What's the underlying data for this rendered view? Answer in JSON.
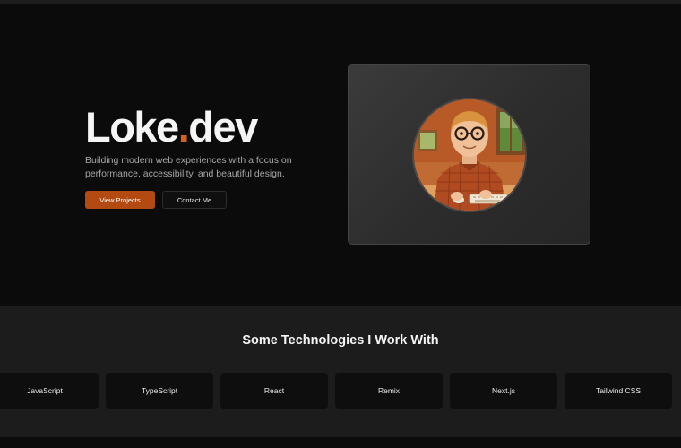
{
  "hero": {
    "brand_name": "Loke",
    "brand_dot": ".",
    "brand_tld": "dev",
    "tagline": "Building modern web experiences with a focus on performance, accessibility, and beautiful design.",
    "primary_button": "View Projects",
    "secondary_button": "Contact Me"
  },
  "technologies": {
    "title": "Some Technologies I Work With",
    "items": [
      "JavaScript",
      "TypeScript",
      "React",
      "Remix",
      "Next.js",
      "Tailwind CSS"
    ]
  },
  "colors": {
    "accent": "#d4621b",
    "primary_button_bg": "#b24a12",
    "page_bg": "#0b0b0b",
    "section_bg": "#1c1c1c"
  }
}
